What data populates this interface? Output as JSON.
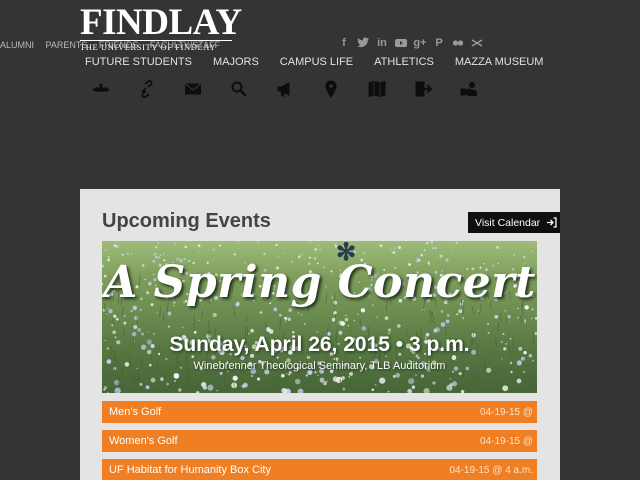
{
  "header": {
    "logo_main": "FINDLAY",
    "logo_sub": "THE UNIVERSITY OF FINDLAY",
    "audience_links": [
      "ALUMNI",
      "PARENTS",
      "FRIENDS",
      "FACULTY/STAFF"
    ],
    "social_icons": [
      "facebook-icon",
      "twitter-icon",
      "linkedin-icon",
      "youtube-icon",
      "googleplus-icon",
      "pinterest-icon",
      "flickr-icon",
      "vine-icon"
    ],
    "main_nav": [
      "FUTURE STUDENTS",
      "MAJORS",
      "CAMPUS LIFE",
      "ATHLETICS",
      "MAZZA MUSEUM"
    ],
    "tools": [
      "oiler-icon",
      "link-icon",
      "mail-icon",
      "search-icon",
      "megaphone-icon",
      "map-pin-icon",
      "map-icon",
      "login-icon",
      "give-icon"
    ]
  },
  "events": {
    "title": "Upcoming Events",
    "visit_label": "Visit Calendar",
    "banner": {
      "headline": "A Spring Concert",
      "date": "Sunday, April 26, 2015 • 3 p.m.",
      "venue": "Winebrenner Theological Seminary, TLB Auditorium"
    },
    "items": [
      {
        "name": "Men's Golf",
        "date": "04-19-15 @"
      },
      {
        "name": "Women's Golf",
        "date": "04-19-15 @"
      },
      {
        "name": "UF Habitat for Humanity Box City",
        "date": "04-19-15 @ 4 a.m."
      }
    ]
  },
  "colors": {
    "background": "#343434",
    "panel": "#e4e4e4",
    "event_bar": "#ef7f22",
    "button": "#0f0f0f"
  }
}
